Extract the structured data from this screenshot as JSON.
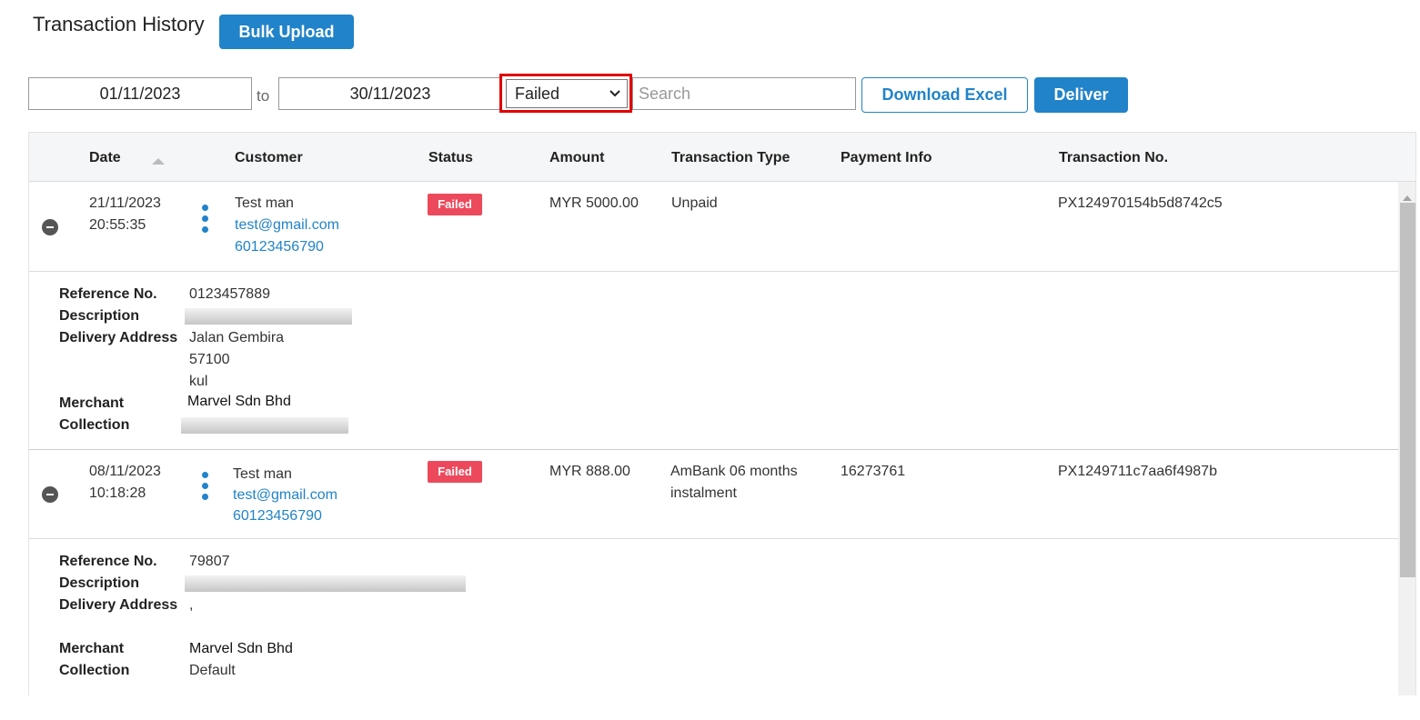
{
  "header": {
    "title": "Transaction History",
    "bulk_upload_label": "Bulk Upload"
  },
  "filters": {
    "date_from": "01/11/2023",
    "to_label": "to",
    "date_to": "30/11/2023",
    "status_selected": "Failed",
    "search_placeholder": "Search",
    "download_excel_label": "Download Excel",
    "deliver_label": "Deliver"
  },
  "table": {
    "columns": [
      "Date",
      "Customer",
      "Status",
      "Amount",
      "Transaction Type",
      "Payment Info",
      "Transaction No."
    ],
    "rows": [
      {
        "date": "21/11/2023",
        "time": "20:55:35",
        "customer_name": "Test man",
        "customer_email": "test@gmail.com",
        "customer_phone": "60123456790",
        "status": "Failed",
        "amount": "MYR 5000.00",
        "transaction_type": "Unpaid",
        "transaction_type_line2": "",
        "payment_info": "",
        "transaction_no": "PX124970154b5d8742c5",
        "details": {
          "reference_label": "Reference No.",
          "reference_value": "0123457889",
          "description_label": "Description",
          "delivery_label": "Delivery Address",
          "address_line1": "Jalan Gembira",
          "address_line2": "57100",
          "address_line3": "kul",
          "merchant_label": "Merchant",
          "merchant_value": "Marvel Sdn Bhd",
          "collection_label": "Collection",
          "collection_value": ""
        }
      },
      {
        "date": "08/11/2023",
        "time": "10:18:28",
        "customer_name": "Test man",
        "customer_email": "test@gmail.com",
        "customer_phone": "60123456790",
        "status": "Failed",
        "amount": "MYR 888.00",
        "transaction_type": "AmBank 06 months",
        "transaction_type_line2": "instalment",
        "payment_info": "16273761",
        "transaction_no": "PX1249711c7aa6f4987b",
        "details": {
          "reference_label": "Reference No.",
          "reference_value": "79807",
          "description_label": "Description",
          "delivery_label": "Delivery Address",
          "address_line1": ",",
          "merchant_label": "Merchant",
          "merchant_value": "Marvel Sdn Bhd",
          "collection_label": "Collection",
          "collection_value": "Default"
        }
      }
    ]
  },
  "colors": {
    "primary": "#2183c9",
    "failed_badge": "#ec4a5c",
    "highlight": "#e00000"
  }
}
